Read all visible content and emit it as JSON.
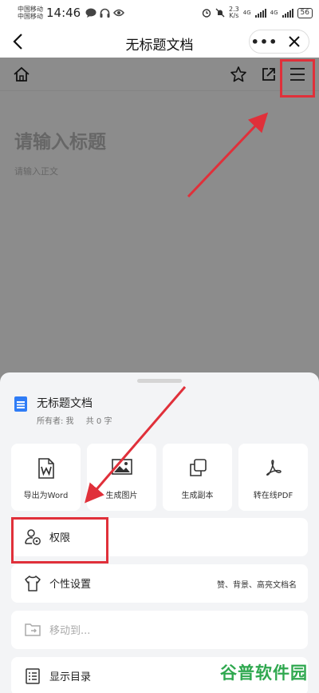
{
  "status_bar": {
    "carrier_1": "中国移动",
    "carrier_2": "中国移动",
    "time": "14:46",
    "net_speed_value": "2.3",
    "net_speed_unit": "K/s",
    "net_type_1": "4G",
    "net_type_2": "4G",
    "battery": "56"
  },
  "header": {
    "title": "无标题文档",
    "more_label": "•••",
    "back_icon": "chevron-left-icon",
    "close_icon": "close-icon"
  },
  "editor": {
    "title_placeholder": "请输入标题",
    "body_placeholder": "请输入正文",
    "toolbar_icons": [
      "home-icon",
      "star-icon",
      "share-icon",
      "menu-icon"
    ]
  },
  "sheet": {
    "doc_name": "无标题文档",
    "owner": "所有者: 我",
    "word_count": "共 0 字",
    "actions": [
      {
        "label": "导出为Word",
        "icon": "word-icon"
      },
      {
        "label": "生成图片",
        "icon": "image-icon"
      },
      {
        "label": "生成副本",
        "icon": "copy-icon"
      },
      {
        "label": "转在线PDF",
        "icon": "pdf-icon"
      }
    ],
    "rows": [
      {
        "label": "权限",
        "icon": "user-settings-icon"
      },
      {
        "label": "个性设置",
        "icon": "tshirt-icon",
        "right": "赞、背景、高亮文档名"
      },
      {
        "label": "移动到...",
        "icon": "folder-move-icon"
      },
      {
        "label": "显示目录",
        "icon": "toc-icon"
      }
    ]
  },
  "watermark": "谷普软件园",
  "colors": {
    "accent": "#2f7cf6",
    "highlight": "#e0303a",
    "watermark": "#2fa84f"
  }
}
